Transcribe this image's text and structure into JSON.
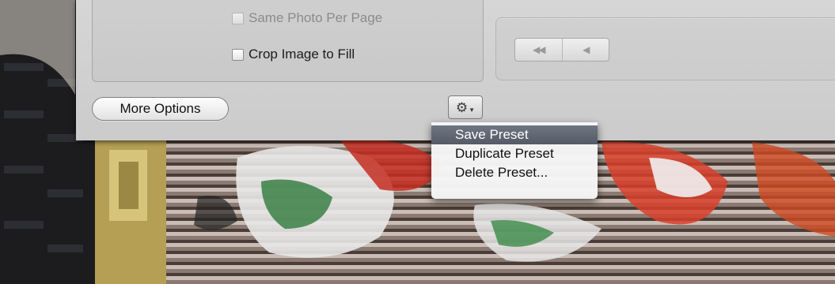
{
  "print_options": {
    "same_photo_per_page": {
      "label": "Same Photo Per Page",
      "checked": false,
      "enabled": false
    },
    "crop_image_to_fill": {
      "label": "Crop Image to Fill",
      "checked": false,
      "enabled": true
    }
  },
  "buttons": {
    "more_options": "More Options",
    "settings_icon": "gear-icon"
  },
  "navigation": {
    "first_icon": "rewind-icon",
    "previous_icon": "previous-icon"
  },
  "preset_menu": {
    "items": [
      {
        "label": "Save Preset",
        "highlighted": true
      },
      {
        "label": "Duplicate Preset",
        "highlighted": false
      },
      {
        "label": "Delete Preset...",
        "highlighted": false
      }
    ]
  },
  "colors": {
    "panel": "#cfcfcf",
    "menu_highlight": "#5f6671"
  }
}
